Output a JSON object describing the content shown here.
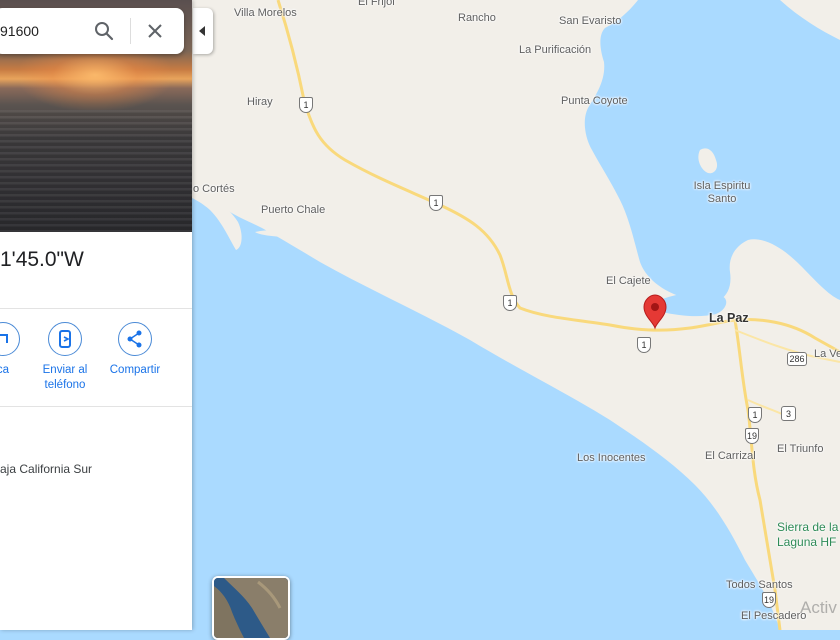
{
  "search": {
    "value": "91600"
  },
  "place": {
    "coordinates_title": "1'45.0\"W",
    "address_line": "aja California Sur"
  },
  "actions": [
    {
      "label": "ca",
      "icon": "nearby-icon"
    },
    {
      "label": "Enviar al teléfono",
      "icon": "phone-icon"
    },
    {
      "label": "Compartir",
      "icon": "share-icon"
    }
  ],
  "map": {
    "labels": {
      "villa_morelos": "Villa Morelos",
      "el_frijol": "El Frijol",
      "rancho": "Rancho",
      "san_evaristo": "San Evaristo",
      "la_purificacion": "La Purificación",
      "hiray": "Hiray",
      "punta_coyote": "Punta Coyote",
      "isla_espiritu_santo": "Isla Espiritu Santo",
      "cortes": "o Cortés",
      "puerto_chale": "Puerto Chale",
      "el_cajete": "El Cajete",
      "la_paz": "La Paz",
      "la_ve": "La Ve",
      "los_inocentes": "Los Inocentes",
      "el_carrizal": "El Carrizal",
      "el_triunfo": "El Triunfo",
      "sierra_laguna": "Sierra de la Laguna HF",
      "todos_santos": "Todos Santos",
      "el_pescadero": "El Pescadero"
    },
    "shields": [
      "1",
      "1",
      "1",
      "1",
      "1",
      "19",
      "3",
      "19",
      "286"
    ],
    "pin_color": "#e53935",
    "water_color": "#aadaff",
    "land_color": "#f2efe9",
    "road_color": "#f9d97c"
  },
  "watermark": "Activ"
}
